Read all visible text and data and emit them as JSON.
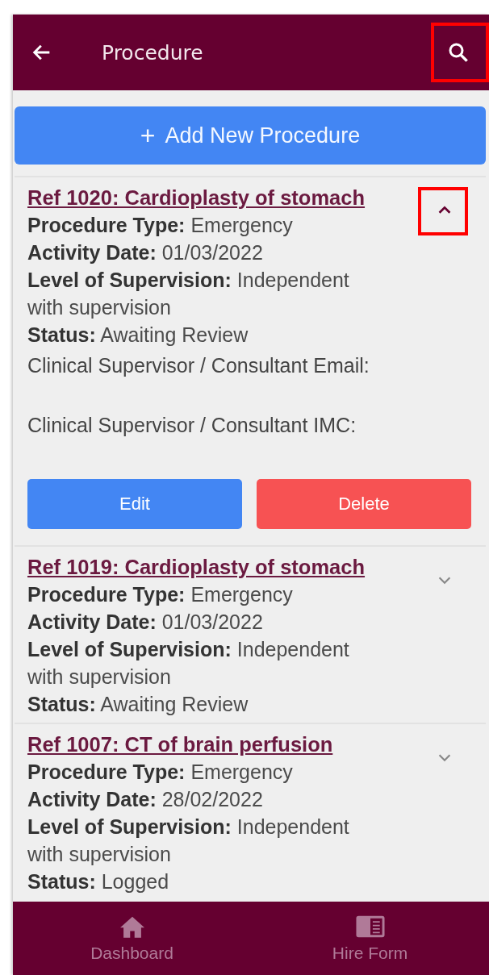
{
  "header": {
    "title": "Procedure",
    "search_highlighted": true
  },
  "add_button": {
    "label": "Add New Procedure",
    "icon": "+"
  },
  "procedures": [
    {
      "title": "Ref 1020: Cardioplasty of stomach",
      "expanded": true,
      "highlighted": true,
      "fields": [
        {
          "label": "Procedure Type:",
          "value": "Emergency"
        },
        {
          "label": "Activity Date:",
          "value": "01/03/2022"
        },
        {
          "label": "Level of Supervision:",
          "value": "Independent with supervision"
        },
        {
          "label": "Status:",
          "value": "Awaiting Review"
        }
      ],
      "details": [
        "Clinical Supervisor / Consultant Email:",
        "Clinical Supervisor / Consultant IMC:"
      ],
      "actions": [
        {
          "label": "Edit",
          "kind": "edit"
        },
        {
          "label": "Delete",
          "kind": "delete"
        }
      ]
    },
    {
      "title": "Ref 1019: Cardioplasty of stomach",
      "expanded": false,
      "highlighted": false,
      "fields": [
        {
          "label": "Procedure Type:",
          "value": "Emergency"
        },
        {
          "label": "Activity Date:",
          "value": "01/03/2022"
        },
        {
          "label": "Level of Supervision:",
          "value": "Independent with supervision"
        },
        {
          "label": "Status:",
          "value": "Awaiting Review"
        }
      ]
    },
    {
      "title": "Ref 1007: CT of brain perfusion",
      "expanded": false,
      "highlighted": false,
      "fields": [
        {
          "label": "Procedure Type:",
          "value": "Emergency"
        },
        {
          "label": "Activity Date:",
          "value": "28/02/2022"
        },
        {
          "label": "Level of Supervision:",
          "value": "Independent with supervision"
        },
        {
          "label": "Status:",
          "value": "Logged"
        }
      ]
    }
  ],
  "bottom_nav": [
    {
      "label": "Dashboard",
      "kind": "home"
    },
    {
      "label": "Hire Form",
      "kind": "form"
    }
  ]
}
